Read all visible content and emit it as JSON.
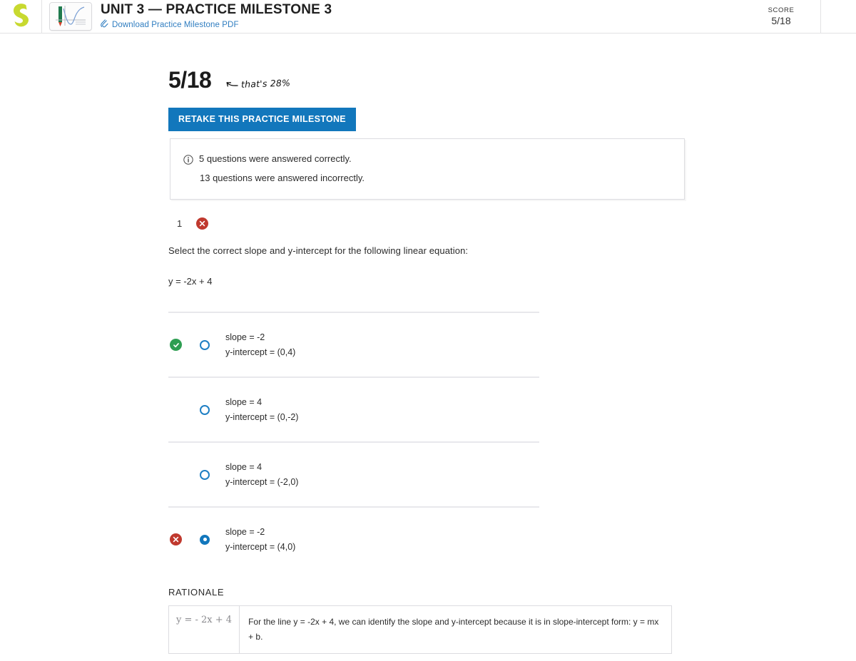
{
  "header": {
    "logo_name": "sophia-logo",
    "thumbnail_name": "course-thumbnail",
    "unit_title": "UNIT 3 — PRACTICE MILESTONE 3",
    "pdf_link_label": "Download Practice Milestone PDF",
    "pdf_icon": "paperclip-icon",
    "score_label": "SCORE",
    "score_value": "5/18",
    "link_color": "#2f7dc0"
  },
  "summary": {
    "big_score": "5/18",
    "annotation_text": "that's 28%",
    "annotation_arrow": "left-arrow-icon",
    "retake_button_label": "RETAKE THIS PRACTICE MILESTONE",
    "retake_button_color": "#1277bc",
    "info_icon": "info-circle-icon",
    "correct_line": "5 questions were answered correctly.",
    "incorrect_line": "13 questions were answered incorrectly."
  },
  "question": {
    "number": "1",
    "result_badge": "wrong",
    "prompt": "Select the correct slope and y-intercept for the following linear equation:",
    "equation": "y = -2x + 4",
    "options": [
      {
        "line1": "slope = -2",
        "line2": "y-intercept = (0,4)",
        "selected": false,
        "status": "correct"
      },
      {
        "line1": "slope = 4",
        "line2": "y-intercept = (0,-2)",
        "selected": false,
        "status": "none"
      },
      {
        "line1": "slope = 4",
        "line2": "y-intercept = (-2,0)",
        "selected": false,
        "status": "none"
      },
      {
        "line1": "slope = -2",
        "line2": "y-intercept = (4,0)",
        "selected": true,
        "status": "incorrect"
      }
    ]
  },
  "rationale": {
    "title": "RATIONALE",
    "equation_cell": "y = - 2x + 4",
    "explanation": "For the line y = -2x + 4, we can identify the slope and y-intercept because it is in slope-intercept form: y = mx + b."
  },
  "colors": {
    "accent_blue": "#1277bc",
    "correct_green": "#2e9e52",
    "incorrect_red": "#c0392e",
    "logo_green": "#c8d930"
  }
}
